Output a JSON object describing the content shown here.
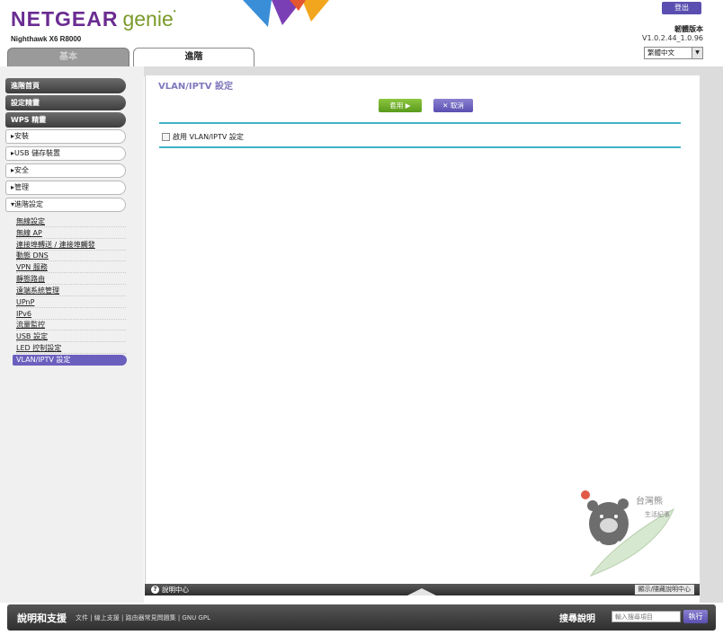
{
  "header": {
    "brand": "NETGEAR",
    "brand_suffix": "genie",
    "model": "Nighthawk X6 R8000",
    "logout_label": "登出",
    "firmware_title": "韌體版本",
    "firmware_version": "V1.0.2.44_1.0.96",
    "language": "繁體中文"
  },
  "tabs": [
    {
      "label": "基本",
      "active": false
    },
    {
      "label": "進階",
      "active": true
    }
  ],
  "sidebar": {
    "top_items": [
      "進階首頁",
      "設定精靈",
      "WPS 精靈"
    ],
    "sections": [
      "▸安裝",
      "▸USB 儲存裝置",
      "▸安全",
      "▸管理",
      "▾進階設定"
    ],
    "sub_items": [
      "無線設定",
      "無線 AP",
      "連接埠轉送 / 連接埠觸發",
      "動態 DNS",
      "VPN 服務",
      "靜態路由",
      "遠端系統管理",
      "UPnP",
      "IPv6",
      "流量監控",
      "USB 設定",
      "LED 控制設定",
      "VLAN/IPTV 設定"
    ],
    "active_sub": "VLAN/IPTV 設定"
  },
  "main": {
    "title": "VLAN/IPTV 設定",
    "apply_label": "套用 ▶",
    "cancel_label": "✕ 取消",
    "enable_checkbox_label": "啟用 VLAN/IPTV 設定",
    "enable_checked": false
  },
  "help_bar": {
    "label": "說明中心",
    "right_label": "顯示/隱藏說明中心"
  },
  "footer": {
    "title": "說明和支援",
    "links": "文件 | 線上支援 | 路由器常見問題集 | GNU GPL",
    "search_label": "搜尋說明",
    "search_placeholder": "輸入搜尋項目",
    "go_label": "執行"
  },
  "colors": {
    "brand_purple": "#6a2c91",
    "brand_green": "#7a9a2a",
    "accent_purple": "#6b5fbe",
    "rule_teal": "#3fb3c8",
    "apply_green": "#6fae2a"
  }
}
